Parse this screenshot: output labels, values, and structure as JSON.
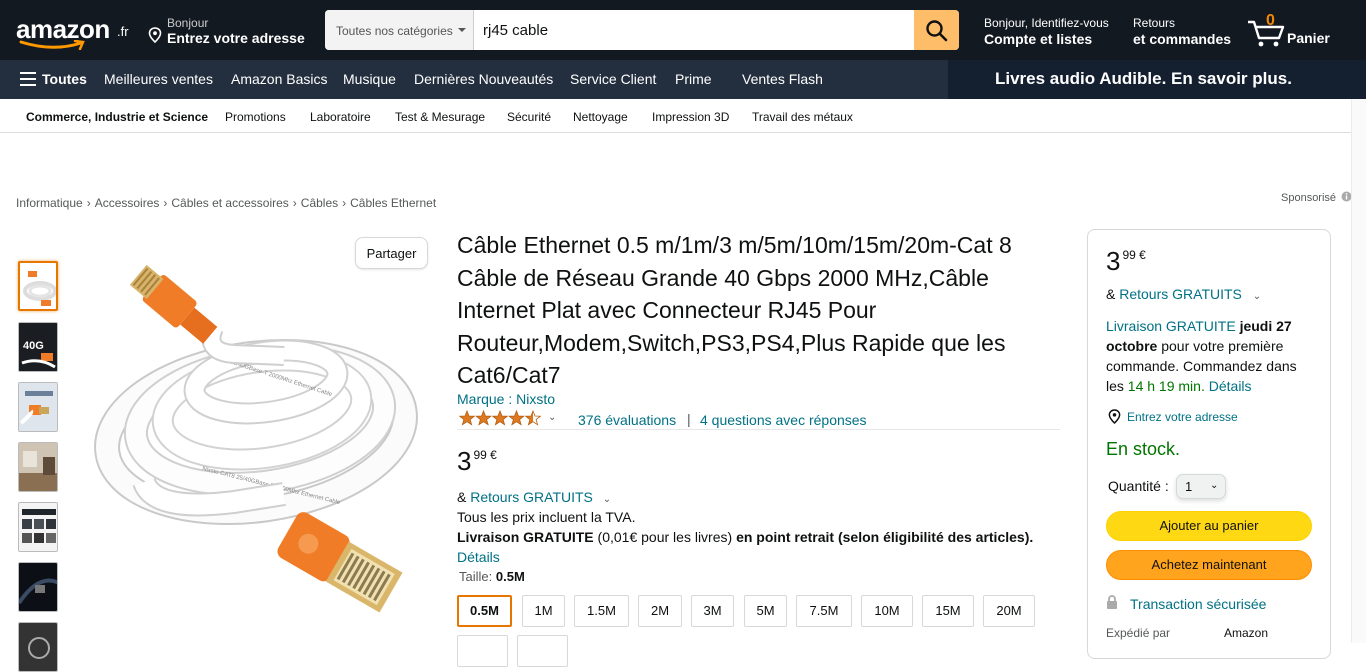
{
  "header": {
    "logo": {
      "word": "amazon",
      "tld": ".fr"
    },
    "deliver": {
      "line1": "Bonjour",
      "line2": "Entrez votre adresse"
    },
    "search": {
      "category": "Toutes nos catégories",
      "value": "rj45 cable"
    },
    "account": {
      "line1": "Bonjour, Identifiez-vous",
      "line2": "Compte et listes"
    },
    "orders": {
      "line1": "Retours",
      "line2": "et commandes"
    },
    "cart": {
      "count": "0",
      "label": "Panier"
    }
  },
  "nav": {
    "all": "Toutes",
    "items": [
      "Meilleures ventes",
      "Amazon Basics",
      "Musique",
      "Dernières Nouveautés",
      "Service Client",
      "Prime",
      "Ventes Flash"
    ],
    "promo": "Livres audio Audible. En savoir plus."
  },
  "subnav": [
    "Commerce, Industrie et Science",
    "Promotions",
    "Laboratoire",
    "Test & Mesurage",
    "Sécurité",
    "Nettoyage",
    "Impression 3D",
    "Travail des métaux"
  ],
  "breadcrumb": [
    "Informatique",
    "Accessoires",
    "Câbles et accessoires",
    "Câbles",
    "Câbles Ethernet"
  ],
  "breadcrumb_sep": "›",
  "sponsored": "Sponsorisé",
  "share_label": "Partager",
  "product": {
    "title": "Câble Ethernet 0.5 m/1m/3 m/5m/10m/15m/20m-Cat 8 Câble de Réseau Grande 40 Gbps 2000 MHz,Câble Internet Plat avec Connecteur RJ45 Pour Routeur,Modem,Switch,PS3,PS4,Plus Rapide que les Cat6/Cat7",
    "brand": "Marque : Nixsto",
    "rating": 4.5,
    "reviews": "376 évaluations",
    "separator": "|",
    "questions": "4 questions avec réponses",
    "price_whole": "3",
    "price_fraction": "99 €",
    "returns_prefix": "&",
    "returns_link": "Retours GRATUITS",
    "tva": "Tous les prix incluent la TVA.",
    "livraison_bold": "Livraison GRATUITE",
    "livraison_mid": " (0,01€ pour les livres) ",
    "livraison_tail": "en point retrait (selon éligibilité des articles).",
    "details": "Détails",
    "size_label": "Taille:",
    "size_value": "0.5M",
    "sizes": [
      "0.5M",
      "1M",
      "1.5M",
      "2M",
      "3M",
      "5M",
      "7.5M",
      "10M",
      "15M",
      "20M"
    ],
    "cable_print_1": "Nixsto  CAT8  25/40GBase-T  2000Mhz  Ethernet  Cable",
    "cable_print_2": "CAT8  25/40GBase-T  2000Mhz  Ethernet  Cable"
  },
  "buybox": {
    "price_whole": "3",
    "price_fraction": "99 €",
    "returns_prefix": "&",
    "returns_link": "Retours GRATUITS",
    "delivery_link": "Livraison GRATUITE",
    "delivery_date": "jeudi 27 octobre",
    "delivery_text": "pour votre première commande. Commandez dans les",
    "delivery_time": "14 h 19 min.",
    "delivery_details": "Détails",
    "address": "Entrez votre adresse",
    "stock": "En stock.",
    "qty_label": "Quantité :",
    "qty_value": "1",
    "add_to_cart": "Ajouter au panier",
    "buy_now": "Achetez maintenant",
    "secure": "Transaction sécurisée",
    "ship_label": "Expédié par",
    "ship_value": "Amazon"
  },
  "colors": {
    "accent_orange": "#e77600",
    "link": "#007185",
    "in_stock": "#007600",
    "cable_orange": "#f07c28"
  }
}
